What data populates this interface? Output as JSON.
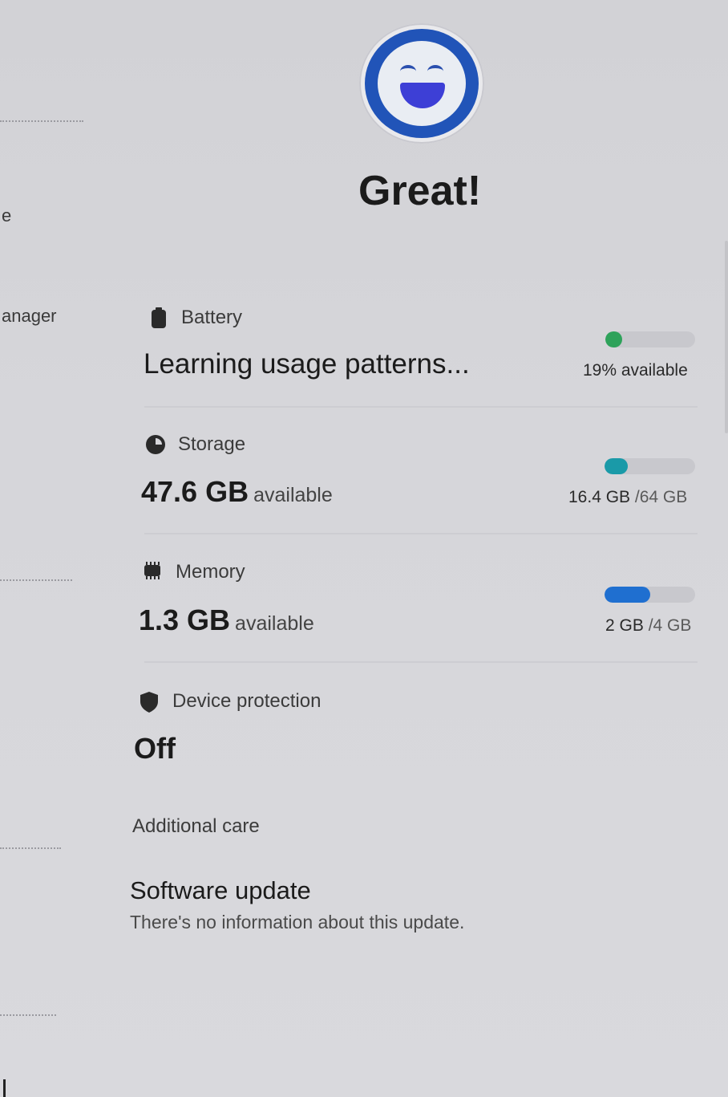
{
  "left_panel": {
    "fragments": [
      "e",
      "anager"
    ]
  },
  "status": {
    "title": "Great!",
    "icon": "smiley-face-icon",
    "accent": "#2154b8"
  },
  "battery": {
    "label": "Battery",
    "value": "Learning usage patterns...",
    "caption": "19% available",
    "level": 0.19,
    "color": "#2ea25a",
    "icon": "battery-icon"
  },
  "storage": {
    "label": "Storage",
    "value": "47.6 GB",
    "unit": "available",
    "used": "16.4 GB",
    "total": "/64 GB",
    "level": 0.26,
    "color": "#1a9aa8",
    "icon": "storage-pie-icon"
  },
  "memory": {
    "label": "Memory",
    "value": "1.3 GB",
    "unit": "available",
    "used": "2 GB",
    "total": "/4 GB",
    "level": 0.5,
    "color": "#1f6fd0",
    "icon": "memory-chip-icon"
  },
  "protection": {
    "label": "Device protection",
    "value": "Off",
    "icon": "shield-icon"
  },
  "additional_care": {
    "header": "Additional care",
    "items": [
      {
        "title": "Software update",
        "subtitle": "There's no information about this update."
      }
    ]
  }
}
